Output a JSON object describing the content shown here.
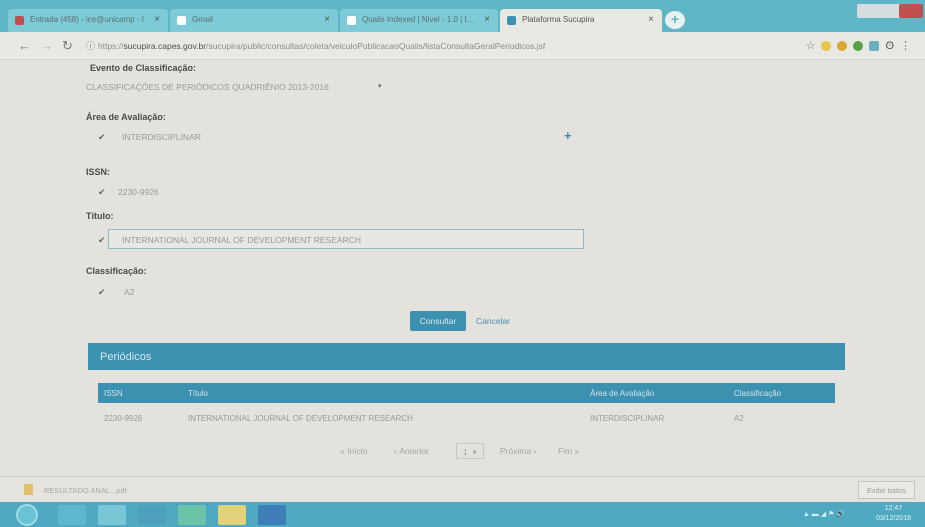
{
  "browser": {
    "tabs": [
      {
        "label": "Entrada (458) - ice@unicamp · I",
        "fav_color": "#c0504d"
      },
      {
        "label": "Gmail",
        "fav_color": "#ffffff"
      },
      {
        "label": "Qualis Indexed | Nivel - 1.0 | I...",
        "fav_color": "#ffffff"
      },
      {
        "label": "Plataforma Sucupira",
        "fav_color": "#3c90b0"
      }
    ],
    "url_prefix": "https://",
    "url_host": "sucupira.capes.gov.br",
    "url_path": "/sucupira/public/consultas/coleta/veiculoPublicacaoQualis/listaConsultaGeralPeriodicos.jsf"
  },
  "form": {
    "evento_label": "Evento de Classificação:",
    "evento_value": "CLASSIFICAÇÕES DE PERIÓDICOS QUADRIÊNIO 2013-2016",
    "area_label": "Área de Avaliação:",
    "area_value": "INTERDISCIPLINAR",
    "issn_label": "ISSN:",
    "issn_value": "2230-9926",
    "titulo_label": "Título:",
    "titulo_value": "INTERNATIONAL JOURNAL OF DEVELOPMENT RESEARCH",
    "class_label": "Classificação:",
    "class_value": "A2",
    "consultar": "Consultar",
    "cancelar": "Cancelar"
  },
  "results": {
    "panel_title": "Periódicos",
    "headers": [
      "ISSN",
      "Título",
      "Área de Avaliação",
      "Classificação"
    ],
    "rows": [
      [
        "2230-9926",
        "INTERNATIONAL JOURNAL OF DEVELOPMENT RESEARCH",
        "INTERDISCIPLINAR",
        "A2"
      ]
    ]
  },
  "pager": {
    "first": "Início",
    "prev": "Anterior",
    "page": "1",
    "next": "Próxima",
    "last": "Fim"
  },
  "downloads": {
    "file": "RESULTADO ANAL...pdf",
    "show_all": "Exibir todos"
  },
  "taskbar": {
    "time": "12:47",
    "date": "03/12/2018"
  }
}
